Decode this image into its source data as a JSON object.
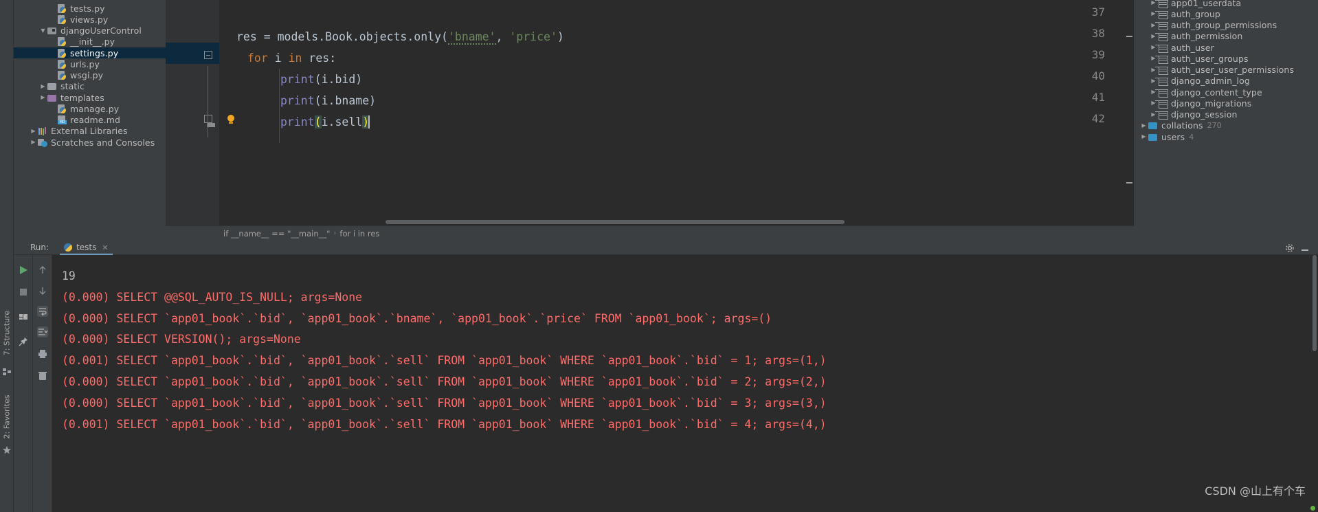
{
  "project_tree": {
    "items": [
      {
        "label": "tests.py",
        "icon": "python-file-icon",
        "indent": 3,
        "arrow": "",
        "selected": false
      },
      {
        "label": "views.py",
        "icon": "python-file-icon",
        "indent": 3,
        "arrow": "",
        "selected": false
      },
      {
        "label": "djangoUserControl",
        "icon": "module-folder-icon",
        "indent": 2,
        "arrow": "▼",
        "selected": false
      },
      {
        "label": "__init__.py",
        "icon": "python-file-icon",
        "indent": 3,
        "arrow": "",
        "selected": false
      },
      {
        "label": "settings.py",
        "icon": "python-file-icon",
        "indent": 3,
        "arrow": "",
        "selected": true
      },
      {
        "label": "urls.py",
        "icon": "python-file-icon",
        "indent": 3,
        "arrow": "",
        "selected": false
      },
      {
        "label": "wsgi.py",
        "icon": "python-file-icon",
        "indent": 3,
        "arrow": "",
        "selected": false
      },
      {
        "label": "static",
        "icon": "folder-icon",
        "indent": 2,
        "arrow": "▶",
        "selected": false
      },
      {
        "label": "templates",
        "icon": "folder-purple-icon",
        "indent": 2,
        "arrow": "▶",
        "selected": false
      },
      {
        "label": "manage.py",
        "icon": "python-file-icon",
        "indent": 3,
        "arrow": "",
        "selected": false
      },
      {
        "label": "readme.md",
        "icon": "markdown-file-icon",
        "indent": 3,
        "arrow": "",
        "selected": false
      },
      {
        "label": "External Libraries",
        "icon": "libraries-icon",
        "indent": 1,
        "arrow": "▶",
        "selected": false
      },
      {
        "label": "Scratches and Consoles",
        "icon": "scratches-icon",
        "indent": 1,
        "arrow": "▶",
        "selected": false
      }
    ]
  },
  "editor": {
    "lines": [
      {
        "num": "37",
        "fold": "",
        "bulb": false,
        "indent_guide": false
      },
      {
        "num": "38",
        "fold": "",
        "bulb": false,
        "indent_guide": false
      },
      {
        "num": "39",
        "fold": "minus",
        "bulb": false,
        "indent_guide": false
      },
      {
        "num": "40",
        "fold": "",
        "bulb": false,
        "indent_guide": true
      },
      {
        "num": "41",
        "fold": "",
        "bulb": false,
        "indent_guide": true
      },
      {
        "num": "42",
        "fold": "end",
        "bulb": true,
        "indent_guide": true
      }
    ],
    "code": {
      "l38_a": "res = models.Book.objects.only(",
      "l38_str1": "'bname'",
      "l38_comma": ", ",
      "l38_str2": "'price'",
      "l38_close": ")",
      "l39_for": "for",
      "l39_i": " i ",
      "l39_in": "in",
      "l39_res": " res:",
      "l40_fn": "print",
      "l40_arg": "(i.bid)",
      "l41_fn": "print",
      "l41_arg": "(i.bname)",
      "l42_fn": "print",
      "l42_open": "(",
      "l42_arg": "i.sell",
      "l42_close": ")"
    },
    "breadcrumb": {
      "crumb1": "if __name__ == \"__main__\"",
      "separator": "›",
      "crumb2": "for i in res"
    }
  },
  "database_tree": {
    "items": [
      {
        "label": "app01_userdata",
        "icon": "db-table-icon",
        "indent": 2,
        "arrow": "▶",
        "count": ""
      },
      {
        "label": "auth_group",
        "icon": "db-table-icon",
        "indent": 2,
        "arrow": "▶",
        "count": ""
      },
      {
        "label": "auth_group_permissions",
        "icon": "db-table-icon",
        "indent": 2,
        "arrow": "▶",
        "count": ""
      },
      {
        "label": "auth_permission",
        "icon": "db-table-icon",
        "indent": 2,
        "arrow": "▶",
        "count": ""
      },
      {
        "label": "auth_user",
        "icon": "db-table-icon",
        "indent": 2,
        "arrow": "▶",
        "count": ""
      },
      {
        "label": "auth_user_groups",
        "icon": "db-table-icon",
        "indent": 2,
        "arrow": "▶",
        "count": ""
      },
      {
        "label": "auth_user_user_permissions",
        "icon": "db-table-icon",
        "indent": 2,
        "arrow": "▶",
        "count": ""
      },
      {
        "label": "django_admin_log",
        "icon": "db-table-icon",
        "indent": 2,
        "arrow": "▶",
        "count": ""
      },
      {
        "label": "django_content_type",
        "icon": "db-table-icon",
        "indent": 2,
        "arrow": "▶",
        "count": ""
      },
      {
        "label": "django_migrations",
        "icon": "db-table-icon",
        "indent": 2,
        "arrow": "▶",
        "count": ""
      },
      {
        "label": "django_session",
        "icon": "db-table-icon",
        "indent": 2,
        "arrow": "▶",
        "count": ""
      },
      {
        "label": "collations",
        "icon": "db-folder-icon",
        "indent": 1,
        "arrow": "▶",
        "count": "270"
      },
      {
        "label": "users",
        "icon": "db-folder-icon",
        "indent": 1,
        "arrow": "▶",
        "count": "4"
      }
    ]
  },
  "left_tool_rail": {
    "structure_label": "7: Structure",
    "favorites_label": "2: Favorites"
  },
  "run_panel": {
    "title": "Run:",
    "tab_label": "tests",
    "tab_close": "✕",
    "toolbar_buttons": [
      "rerun-button",
      "stop-button",
      "restore-layout-button",
      "pin-tab-button",
      "up-stack-button",
      "down-stack-button",
      "soft-wrap-button",
      "scroll-to-end-button",
      "print-button",
      "clear-all-button"
    ],
    "header_buttons": [
      "settings-gear-button",
      "hide-panel-button"
    ],
    "console_lines": [
      {
        "text": "19",
        "type": "output"
      },
      {
        "text": "(0.000) SELECT @@SQL_AUTO_IS_NULL; args=None",
        "type": "error"
      },
      {
        "text": "(0.000) SELECT `app01_book`.`bid`, `app01_book`.`bname`, `app01_book`.`price` FROM `app01_book`; args=()",
        "type": "error"
      },
      {
        "text": "(0.000) SELECT VERSION(); args=None",
        "type": "error"
      },
      {
        "text": "(0.001) SELECT `app01_book`.`bid`, `app01_book`.`sell` FROM `app01_book` WHERE `app01_book`.`bid` = 1; args=(1,)",
        "type": "error"
      },
      {
        "text": "(0.000) SELECT `app01_book`.`bid`, `app01_book`.`sell` FROM `app01_book` WHERE `app01_book`.`bid` = 2; args=(2,)",
        "type": "error"
      },
      {
        "text": "(0.000) SELECT `app01_book`.`bid`, `app01_book`.`sell` FROM `app01_book` WHERE `app01_book`.`bid` = 3; args=(3,)",
        "type": "error"
      },
      {
        "text": "(0.001) SELECT `app01_book`.`bid`, `app01_book`.`sell` FROM `app01_book` WHERE `app01_book`.`bid` = 4; args=(4,)",
        "type": "error"
      }
    ]
  },
  "watermark": {
    "text": "CSDN @山上有个车"
  },
  "colors": {
    "panel_bg": "#3c3f41",
    "editor_bg": "#2b2b2b",
    "selection": "#0d293e",
    "keyword": "#cc7832",
    "string": "#6a8759",
    "function": "#8888c6",
    "error_text": "#ff6b68",
    "accent_tab": "#6d9cbe"
  }
}
